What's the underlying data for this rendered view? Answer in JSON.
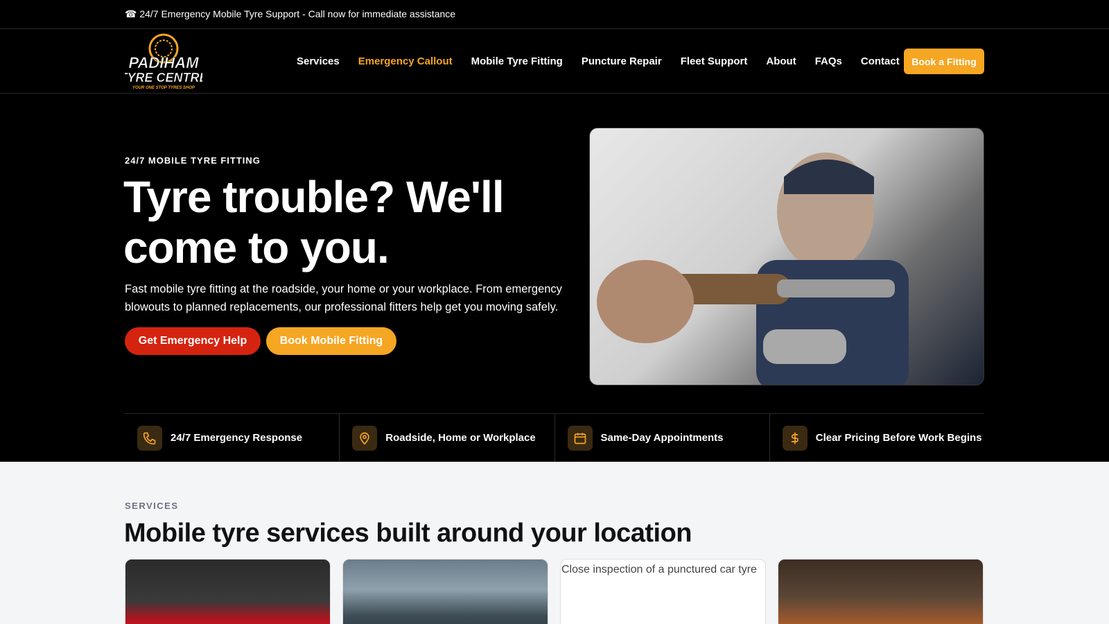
{
  "topbar": {
    "message": "☎ 24/7 Emergency Mobile Tyre Support - Call now for immediate assistance"
  },
  "brand": {
    "logo_line1": "PADIHAM",
    "logo_line2": "TYRE CENTRE",
    "logo_tagline": "YOUR ONE STOP TYRES SHOP"
  },
  "nav": {
    "items": [
      {
        "label": "Services"
      },
      {
        "label": "Emergency Callout",
        "active": true
      },
      {
        "label": "Mobile Tyre Fitting"
      },
      {
        "label": "Puncture Repair"
      },
      {
        "label": "Fleet Support"
      },
      {
        "label": "About"
      },
      {
        "label": "FAQs"
      },
      {
        "label": "Contact"
      }
    ],
    "cta_label": "Book a Fitting"
  },
  "hero": {
    "eyebrow": "24/7 MOBILE TYRE FITTING",
    "headline": "Tyre trouble? We'll come to you.",
    "lead": "Fast mobile tyre fitting at the roadside, your home or your workplace. From emergency blowouts to planned replacements, our professional fitters help get you moving safely.",
    "primary_cta": "Get Emergency Help",
    "secondary_cta": "Book Mobile Fitting"
  },
  "features": [
    {
      "icon": "phone-icon",
      "label": "24/7 Emergency Response"
    },
    {
      "icon": "map-pin-icon",
      "label": "Roadside, Home or Workplace"
    },
    {
      "icon": "calendar-icon",
      "label": "Same-Day Appointments"
    },
    {
      "icon": "dollar-icon",
      "label": "Clear Pricing Before Work Begins"
    }
  ],
  "services": {
    "eyebrow": "SERVICES",
    "title": "Mobile tyre services built around your location",
    "broken_image_alt": "Close inspection of a punctured car tyre"
  },
  "colors": {
    "accent": "#f5a623",
    "danger": "#d42410",
    "background": "#000000",
    "section_bg": "#f4f5f7"
  }
}
